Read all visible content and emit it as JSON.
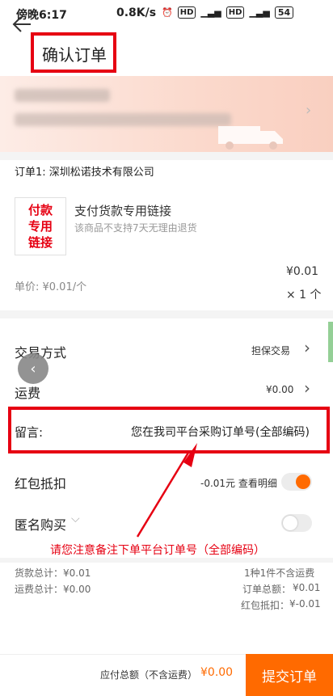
{
  "status_bar": {
    "time": "傍晚6:17",
    "speed": "0.8K/s",
    "battery": "54"
  },
  "header": {
    "title": "确认订单"
  },
  "order": {
    "seller": "订单1: 深圳松诺技术有限公司",
    "product_image_text": [
      "付款",
      "专用",
      "链接"
    ],
    "product_name": "支付货款专用链接",
    "product_note": "该商品不支持7天无理由退货",
    "unit_price": "单价: ¥0.01/个",
    "price": "¥0.01",
    "qty": "× 1 个"
  },
  "rows": {
    "trade_label": "交易方式",
    "trade_value": "担保交易",
    "shipping_label": "运费",
    "shipping_value": "¥0.00",
    "note_label": "留言:",
    "note_value": "您在我司平台采购订单号(全部编码)",
    "redpack_label": "红包抵扣",
    "redpack_value": "-0.01元 查看明细",
    "anon_label": "匿名购买"
  },
  "annotation": "请您注意备注下单平台订单号（全部编码）",
  "summary": {
    "goods_total": "货款总计：¥0.01",
    "ship_total": "运费总计：¥0.00",
    "count_note": "1种1件不含运费",
    "order_total_label": "订单总额：",
    "order_total_value": "¥0.01",
    "redpack_label": "红包抵扣：",
    "redpack_value": "¥-0.01"
  },
  "bottom": {
    "total_label": "应付总额（不含运费）",
    "total_value": "¥0.00",
    "submit": "提交订单"
  },
  "colors": {
    "accent": "#ff6a00",
    "annotation_red": "#e60012"
  }
}
